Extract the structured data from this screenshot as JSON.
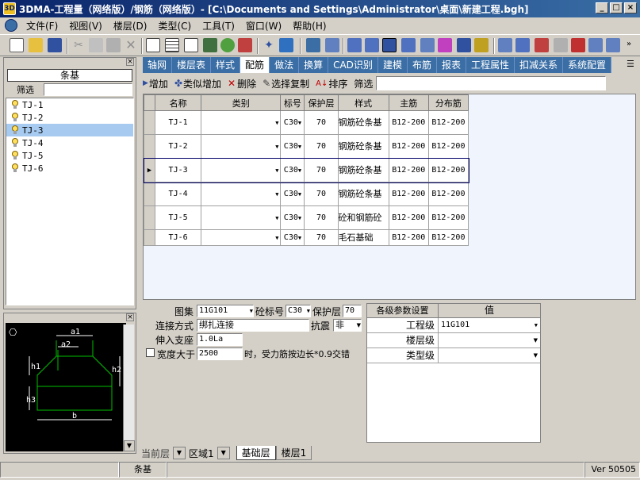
{
  "window": {
    "title": "3DMA-工程量（网络版）/钢筋（网络版）- [C:\\Documents and Settings\\Administrator\\桌面\\新建工程.bgh]"
  },
  "menu": [
    "文件(F)",
    "视图(V)",
    "楼层(D)",
    "类型(C)",
    "工具(T)",
    "窗口(W)",
    "帮助(H)"
  ],
  "left_panel": {
    "title": "条基",
    "filter_label": "筛选",
    "items": [
      "TJ-1",
      "TJ-2",
      "TJ-3",
      "TJ-4",
      "TJ-5",
      "TJ-6"
    ],
    "selected": "TJ-3"
  },
  "tabs": [
    "轴网",
    "楼层表",
    "样式",
    "配筋",
    "做法",
    "换算",
    "CAD识别",
    "建模",
    "布筋",
    "报表",
    "工程属性",
    "扣减关系",
    "系统配置"
  ],
  "active_tab": "配筋",
  "actions": {
    "add": "增加",
    "similar_add": "类似增加",
    "delete": "删除",
    "select_copy": "选择复制",
    "sort": "排序",
    "filter": "筛选"
  },
  "table": {
    "headers": [
      "名称",
      "类别",
      "标号",
      "保护层",
      "样式",
      "主筋",
      "分布筋"
    ],
    "rows": [
      {
        "name": "TJ-1",
        "category": "",
        "grade": "C30",
        "cover": "70",
        "style": "钢筋砼条基",
        "main": "B12-200",
        "dist": "B12-200"
      },
      {
        "name": "TJ-2",
        "category": "",
        "grade": "C30",
        "cover": "70",
        "style": "钢筋砼条基",
        "main": "B12-200",
        "dist": "B12-200"
      },
      {
        "name": "TJ-3",
        "category": "",
        "grade": "C30",
        "cover": "70",
        "style": "钢筋砼条基",
        "main": "B12-200",
        "dist": "B12-200"
      },
      {
        "name": "TJ-4",
        "category": "",
        "grade": "C30",
        "cover": "70",
        "style": "钢筋砼条基",
        "main": "B12-200",
        "dist": "B12-200"
      },
      {
        "name": "TJ-5",
        "category": "",
        "grade": "C30",
        "cover": "70",
        "style": "砼和钢筋砼",
        "main": "B12-200",
        "dist": "B12-200"
      },
      {
        "name": "TJ-6",
        "category": "",
        "grade": "C30",
        "cover": "70",
        "style": "毛石基础",
        "main": "B12-200",
        "dist": "B12-200"
      }
    ],
    "current_row": 2
  },
  "props": {
    "atlas_label": "图集",
    "atlas_value": "11G101",
    "grade_label": "砼标号",
    "grade_value": "C30",
    "cover_label": "保护层",
    "cover_value": "70",
    "conn_label": "连接方式",
    "conn_value": "绑扎连接",
    "seismic_label": "抗震",
    "seismic_value": "非",
    "anchor_label": "伸入支座",
    "anchor_value": "1.0La",
    "width_label": "宽度大于",
    "width_value": "2500",
    "width_suffix": "时，受力筋按边长*0.9交错"
  },
  "params": {
    "col1": "各级参数设置",
    "col2": "值",
    "rows": [
      {
        "label": "工程级",
        "value": "11G101"
      },
      {
        "label": "楼层级",
        "value": ""
      },
      {
        "label": "类型级",
        "value": ""
      }
    ]
  },
  "diagram": {
    "labels": [
      "a1",
      "a2",
      "h1",
      "h2",
      "h3",
      "b"
    ],
    "bottom_cut": [
      "规则",
      "…件"
    ]
  },
  "floor_bar": {
    "label": "当前层",
    "region": "区域1",
    "tabs": [
      "基础层",
      "楼层1"
    ]
  },
  "status": {
    "center": "条基",
    "version": "Ver 50505"
  },
  "colors": {
    "title_start": "#0a246a",
    "title_end": "#3a6ea5",
    "tab_bg": "#3a6ea5",
    "selection": "#a6caf0",
    "diagram_line": "#00c000"
  }
}
